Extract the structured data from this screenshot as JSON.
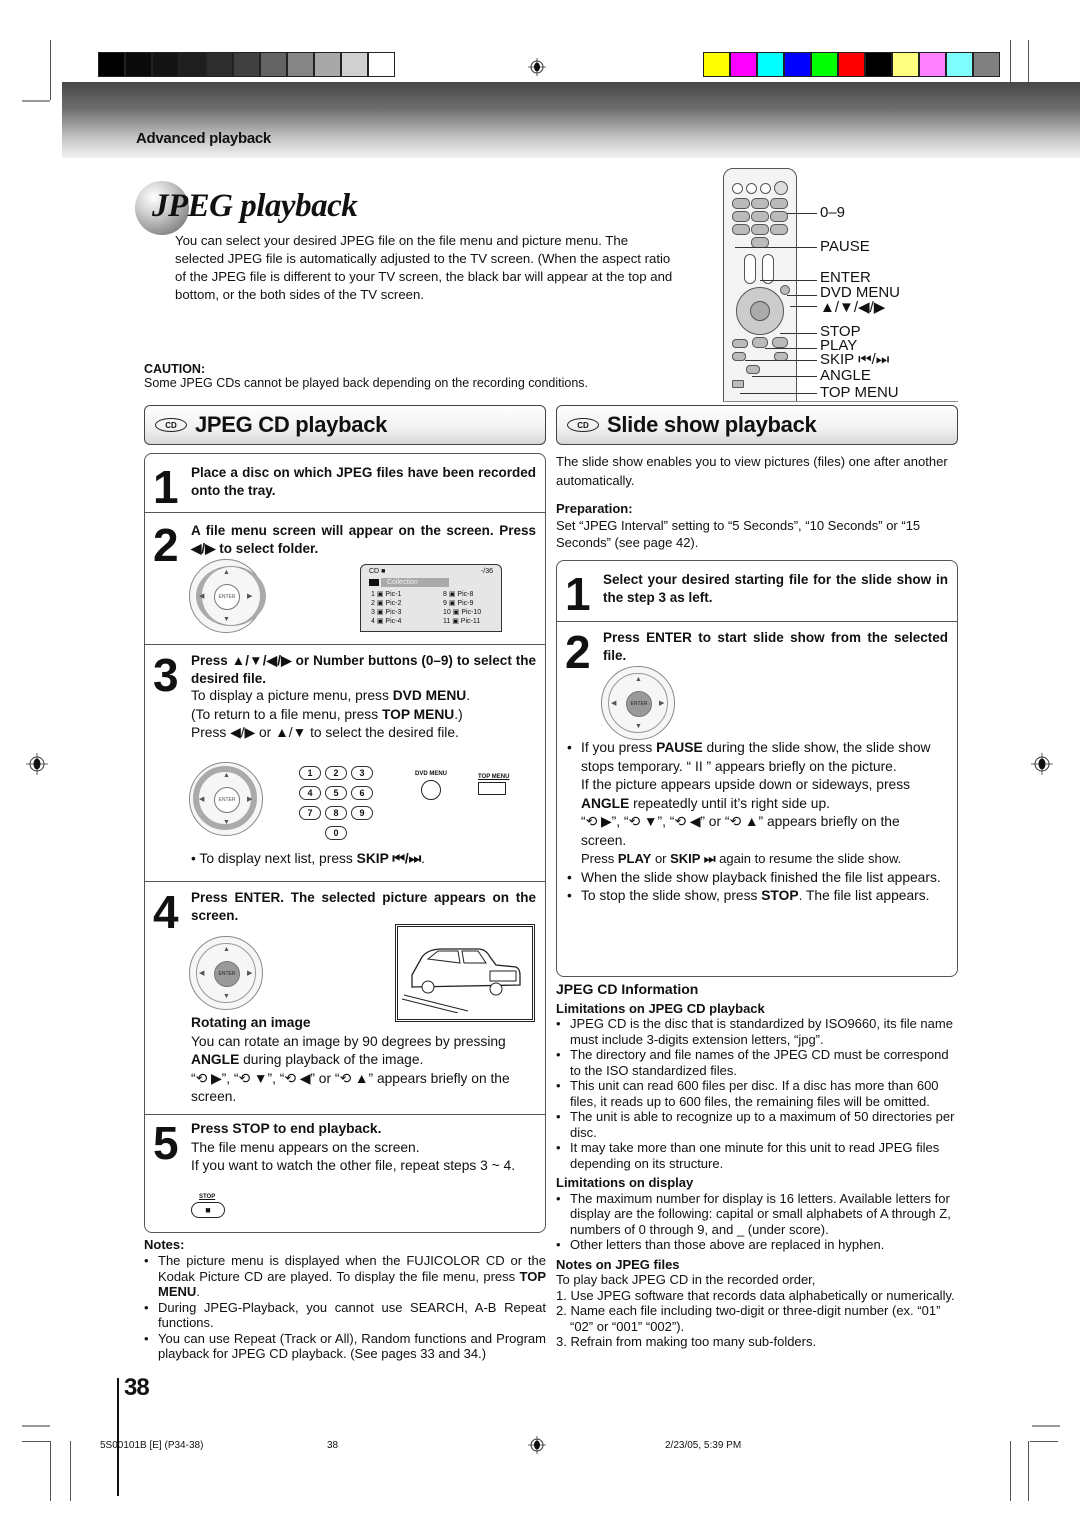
{
  "header": {
    "section_label": "Advanced playback",
    "grayscale_swatches": [
      "#000000",
      "#0a0a0a",
      "#141414",
      "#1e1e1e",
      "#2d2d2d",
      "#404040",
      "#636363",
      "#858585",
      "#a8a8a8",
      "#d0d0d0",
      "#ffffff"
    ],
    "color_swatches": [
      "#ffff00",
      "#ff00ff",
      "#00ffff",
      "#0000ff",
      "#00ff00",
      "#ff0000",
      "#000000",
      "#ffff80",
      "#ff80ff",
      "#80ffff",
      "#808080"
    ]
  },
  "page": {
    "title": "JPEG playback",
    "intro": "You can select your desired JPEG file on the file menu and picture menu. The selected JPEG file is automatically adjusted to the TV screen. (When the aspect ratio of the JPEG file is different to your TV screen, the black bar will appear at the top and bottom, or the both sides of the TV screen.",
    "caution_title": "CAUTION:",
    "caution_text": "Some JPEG CDs cannot be played back depending on the recording conditions.",
    "page_number": "38"
  },
  "remote": {
    "labels": [
      "0–9",
      "PAUSE",
      "ENTER",
      "DVD MENU",
      "▲/▼/◀/▶",
      "STOP",
      "PLAY",
      "SKIP ⏮/⏭",
      "ANGLE",
      "TOP MENU"
    ]
  },
  "jpeg_cd": {
    "banner_icon": "CD",
    "title": "JPEG CD playback",
    "steps": [
      {
        "num": "1",
        "head": "Place a disc on which JPEG files have been recorded onto the tray."
      },
      {
        "num": "2",
        "head": "A file menu screen will appear on the screen. Press ◀/▶ to select folder."
      },
      {
        "num": "3",
        "head": "Press ▲/▼/◀/▶ or Number buttons (0–9) to select the desired file.",
        "line1_pre": "To display a picture menu, press ",
        "line1_bold": "DVD MENU",
        "line1_post": ".",
        "line2_pre": "(To return to a file menu, press ",
        "line2_bold": "TOP MENU",
        "line2_post": ".)",
        "line3": "Press ◀/▶ or ▲/▼ to select the desired file.",
        "bullet_pre": "To display next list, press ",
        "bullet_bold": "SKIP ⏮/⏭",
        "bullet_post": ".",
        "dvd_menu_label": "DVD MENU",
        "top_menu_label": "TOP MENU",
        "num_keys": [
          "1",
          "2",
          "3",
          "4",
          "5",
          "6",
          "7",
          "8",
          "9",
          "0"
        ]
      },
      {
        "num": "4",
        "head": "Press ENTER. The selected picture appears on the screen.",
        "sub_title": "Rotating an image",
        "sub_text_pre": "You can rotate an image by 90 degrees by pressing ",
        "sub_bold": "ANGLE",
        "sub_text_post": " during playback of the image.",
        "rotate_text": "“⟲ ▶”, “⟲ ▼”, “⟲ ◀” or “⟲ ▲” appears briefly on the screen."
      },
      {
        "num": "5",
        "head": "Press STOP to end playback.",
        "line1": "The file menu appears on the screen.",
        "line2": "If you want to watch the other file, repeat steps 3 ~ 4.",
        "stop_label": "STOP",
        "stop_glyph": "■"
      }
    ],
    "file_menu": {
      "cd_label": "CD",
      "counter": "-/36",
      "folder": "Collection",
      "files_left": [
        {
          "n": "1",
          "name": "Pic-1"
        },
        {
          "n": "2",
          "name": "Pic-2"
        },
        {
          "n": "3",
          "name": "Pic-3"
        },
        {
          "n": "4",
          "name": "Pic-4"
        }
      ],
      "files_right": [
        {
          "n": "8",
          "name": "Pic-8"
        },
        {
          "n": "9",
          "name": "Pic-9"
        },
        {
          "n": "10",
          "name": "Pic-10"
        },
        {
          "n": "11",
          "name": "Pic-11"
        }
      ]
    },
    "enter_label": "ENTER",
    "notes_title": "Notes:",
    "notes": [
      {
        "pre": "The picture menu is displayed when the FUJICOLOR CD or the Kodak Picture CD are played. To display the file menu, press ",
        "bold": "TOP MENU",
        "post": "."
      },
      {
        "pre": "During JPEG-Playback, you cannot use SEARCH, A-B Repeat functions.",
        "bold": "",
        "post": ""
      },
      {
        "pre": "You can use Repeat (Track or All), Random functions and Program playback for JPEG CD playback. (See pages 33 and 34.)",
        "bold": "",
        "post": ""
      }
    ]
  },
  "slide_show": {
    "banner_icon": "CD",
    "title": "Slide show playback",
    "intro": "The slide show enables you to view pictures (files) one after another automatically.",
    "prep_title": "Preparation:",
    "prep_text": "Set “JPEG Interval” setting to “5 Seconds”, “10 Seconds” or “15 Seconds” (see page 42).",
    "steps": [
      {
        "num": "1",
        "head": "Select your desired starting file for the slide show in the step 3 as left."
      },
      {
        "num": "2",
        "head": "Press ENTER to start slide show from the selected file."
      }
    ],
    "bullets": {
      "b1_pre": "If you press ",
      "b1_bold": "PAUSE",
      "b1_post": " during the slide show, the slide show stops temporary. “ II ” appears briefly on the picture.",
      "b1_p2_pre": "If the picture appears upside down or sideways, press ",
      "b1_p2_bold": "ANGLE",
      "b1_p2_post": " repeatedly until it’s right side up.",
      "b1_p3": "“⟲ ▶”, “⟲ ▼”, “⟲ ◀” or “⟲ ▲” appears briefly on the screen.",
      "b1_p4_pre": "Press ",
      "b1_p4_b1": "PLAY",
      "b1_p4_mid": " or ",
      "b1_p4_b2": "SKIP ⏭",
      "b1_p4_post": " again to resume the slide show.",
      "b2": "When the slide show playback finished the file list appears.",
      "b3_pre": "To stop the slide show, press ",
      "b3_bold": "STOP",
      "b3_post": ". The file list appears."
    }
  },
  "info": {
    "title": "JPEG CD Information",
    "lim_playback_title": "Limitations on JPEG CD playback",
    "lim_playback": [
      "JPEG CD is the disc that is standardized by ISO9660, its file name must include 3-digits extension letters, “jpg”.",
      "The directory and file names of the JPEG CD must be correspond to the ISO standardized files.",
      "This unit can read 600 files per disc. If a disc has more than 600 files, it reads up to 600 files, the remaining files will be omitted.",
      "The unit is able to recognize up to a maximum of 50 directories per disc.",
      "It may take more than one minute for this unit to read JPEG files depending on its structure."
    ],
    "lim_display_title": "Limitations on display",
    "lim_display": [
      "The maximum number for display is 16 letters. Available letters for display are the following: capital or small alphabets of A through Z, numbers of 0 through 9, and _ (under score).",
      "Other letters than those above are replaced in hyphen."
    ],
    "notes_title": "Notes on JPEG files",
    "notes_intro": "To play back JPEG CD in the recorded order,",
    "notes": [
      "1. Use JPEG software that records data alphabetically or numerically.",
      "2. Name each file including two-digit or three-digit number (ex. “01” “02” or “001” “002”).",
      "3. Refrain from making too many sub-folders."
    ]
  },
  "footer": {
    "code": "5S00101B [E] (P34-38)",
    "page": "38",
    "datetime": "2/23/05, 5:39 PM"
  }
}
